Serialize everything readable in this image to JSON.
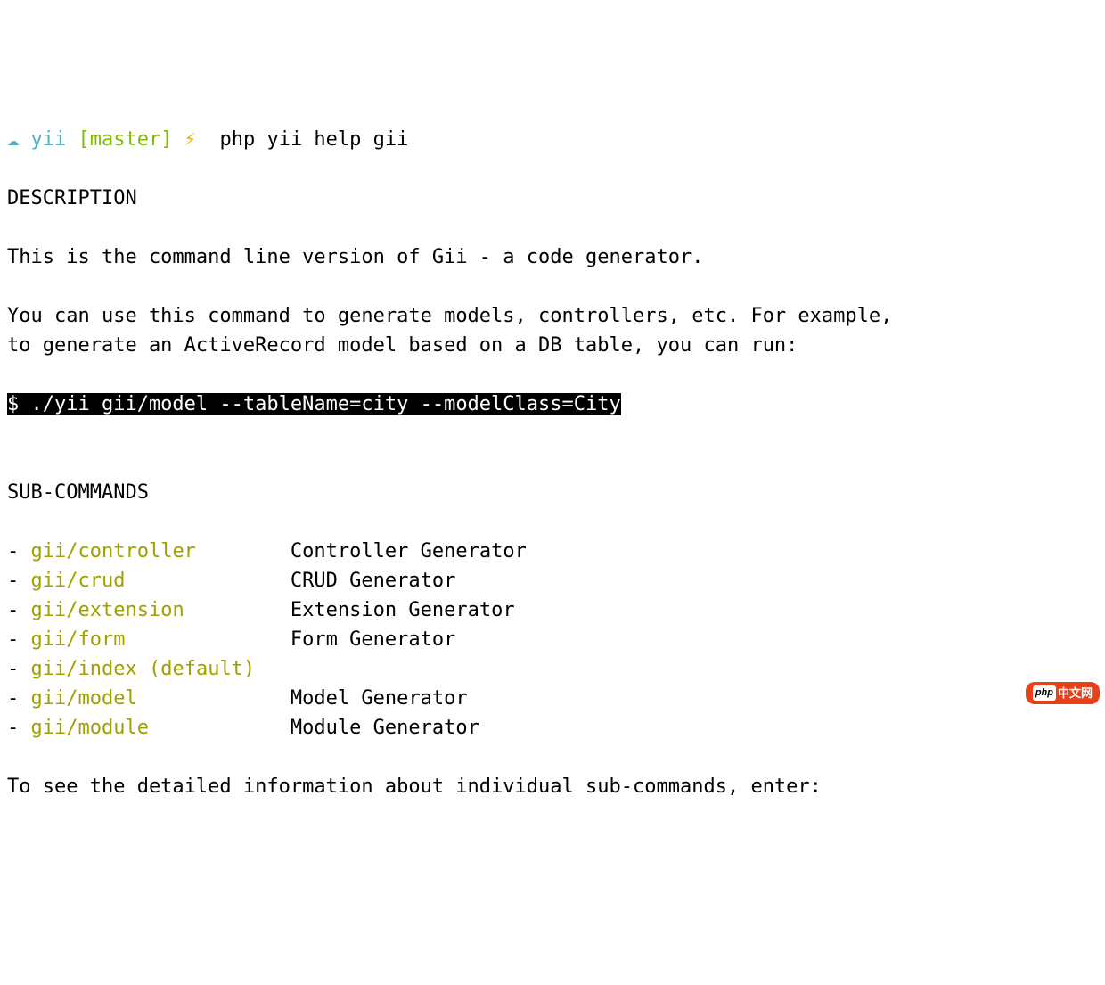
{
  "prompt": {
    "cloud_icon": "☁",
    "dir": "yii",
    "branch": "[master]",
    "bolt": "⚡",
    "command": "php yii help gii"
  },
  "sections": {
    "description_header": "DESCRIPTION",
    "description_line1": "This is the command line version of Gii - a code generator.",
    "description_line2": "You can use this command to generate models, controllers, etc. For example,",
    "description_line3": "to generate an ActiveRecord model based on a DB table, you can run:",
    "example_cmd": "$ ./yii gii/model --tableName=city --modelClass=City",
    "subcommands_header": "SUB-COMMANDS",
    "subcommands": [
      {
        "name": "gii/controller",
        "default": "",
        "desc": "Controller Generator"
      },
      {
        "name": "gii/crud",
        "default": "",
        "desc": "CRUD Generator"
      },
      {
        "name": "gii/extension",
        "default": "",
        "desc": "Extension Generator"
      },
      {
        "name": "gii/form",
        "default": "",
        "desc": "Form Generator"
      },
      {
        "name": "gii/index",
        "default": "(default)",
        "desc": ""
      },
      {
        "name": "gii/model",
        "default": "",
        "desc": "Model Generator"
      },
      {
        "name": "gii/module",
        "default": "",
        "desc": "Module Generator"
      }
    ],
    "footer_line": "To see the detailed information about individual sub-commands, enter:"
  },
  "watermark": {
    "php": "php",
    "text": "中文网"
  }
}
